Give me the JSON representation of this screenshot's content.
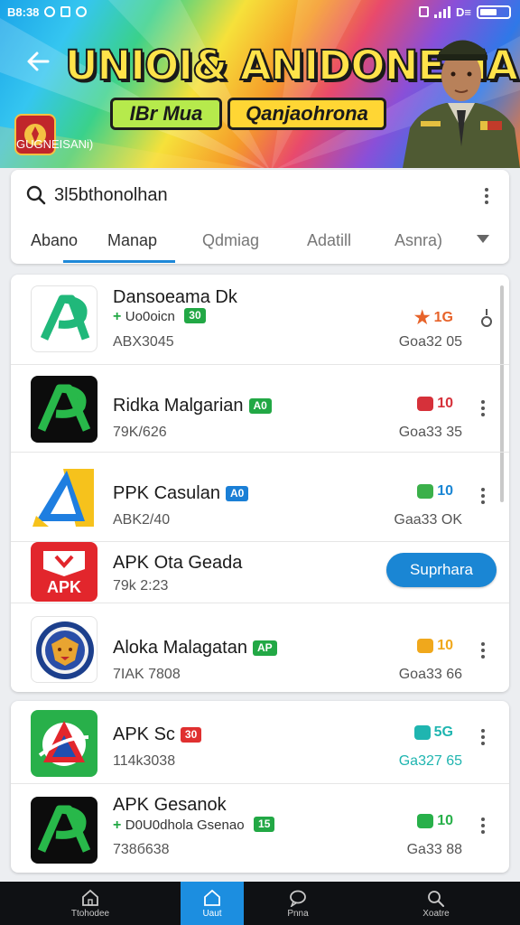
{
  "status_bar": {
    "time": "B8:38",
    "left_icons": [
      "alarm-icon",
      "notification-icon",
      "whatsapp-icon"
    ],
    "right_text": "D≡"
  },
  "banner": {
    "title": "UNIOI& ANIDONESIAN",
    "chip_1": "IBr Mua",
    "chip_2": "Qanjaohrona",
    "emblem_caption": "GUGNEISANi)"
  },
  "search": {
    "value": "3l5bthonolhan"
  },
  "tabs": [
    {
      "label": "Abano"
    },
    {
      "label": "Manap"
    },
    {
      "label": "Qdmiag"
    },
    {
      "label": "Adatill"
    },
    {
      "label": "Asnra)"
    }
  ],
  "apps_group_1": [
    {
      "name": "Dansoeama Dk",
      "developer": "Uo0oicn",
      "badge": "30",
      "meta": "ABX3045",
      "rating": "1G",
      "size": "Goa32 05"
    },
    {
      "name": "Ridka Malgarian",
      "badge": "A0",
      "meta": "79K/626",
      "rating": "10",
      "size": "Goa33 35"
    },
    {
      "name": "PPK Casulan",
      "badge": "A0",
      "meta": "ABK2/40",
      "rating": "10",
      "size": "Gaa33 OK"
    },
    {
      "name": "APK Ota Geada",
      "meta": "79k 2:23",
      "install_label": "Suprhara",
      "icon_text": "APK"
    },
    {
      "name": "Aloka Malagatan",
      "badge": "AP",
      "meta": "7IAK 7808",
      "rating": "10",
      "size": "Goa33 66"
    }
  ],
  "apps_group_2": [
    {
      "name": "APK Sc",
      "badge": "30",
      "meta": "114k3038",
      "rating": "5G",
      "size": "Ga327 65"
    },
    {
      "name": "APK Gesanok",
      "developer": "D0U0dhola Gsenao",
      "badge": "15",
      "meta": "738б638",
      "rating": "10",
      "size": "Ga33 88"
    }
  ],
  "bottom_nav": [
    {
      "label": "Ttohodee"
    },
    {
      "label": "Uaut"
    },
    {
      "label": "Pnna"
    },
    {
      "label": "Xoatre"
    }
  ],
  "colors": {
    "accent": "#1a86d4",
    "nav_bg": "#0f1114",
    "badge_green": "#22a845"
  }
}
